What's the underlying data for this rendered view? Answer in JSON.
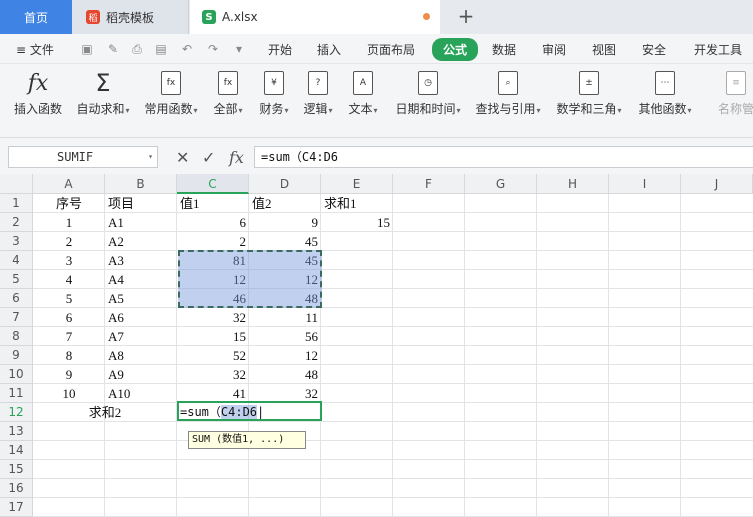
{
  "tabs": {
    "home": "首页",
    "template": "稻壳模板",
    "file": "A.xlsx",
    "template_icon": "稻",
    "file_icon": "S",
    "new_tab_icon": "+"
  },
  "menu": {
    "file": "≡ 文件",
    "items": [
      "开始",
      "插入",
      "页面布局",
      "公式",
      "数据",
      "审阅",
      "视图",
      "安全",
      "开发工具"
    ],
    "active": "公式"
  },
  "ribbon": [
    {
      "label": "插入函数",
      "icon": "fx"
    },
    {
      "label": "自动求和",
      "icon": "Σ"
    },
    {
      "label": "常用函数",
      "icon": "fx"
    },
    {
      "label": "全部",
      "icon": "fx"
    },
    {
      "label": "财务",
      "icon": "¥"
    },
    {
      "label": "逻辑",
      "icon": "?"
    },
    {
      "label": "文本",
      "icon": "A"
    },
    {
      "label": "日期和时间",
      "icon": "◷"
    },
    {
      "label": "查找与引用",
      "icon": "⌕"
    },
    {
      "label": "数学和三角",
      "icon": "±"
    },
    {
      "label": "其他函数",
      "icon": "⋯"
    },
    {
      "label": "名称管",
      "icon": "≡"
    }
  ],
  "formula_bar": {
    "name_box": "SUMIF",
    "cancel_icon": "✕",
    "confirm_icon": "✓",
    "fx_icon": "fx",
    "formula": "=sum（C4:D6"
  },
  "columns": [
    "A",
    "B",
    "C",
    "D",
    "E",
    "F",
    "G",
    "H",
    "I",
    "J"
  ],
  "rows": [
    "1",
    "2",
    "3",
    "4",
    "5",
    "6",
    "7",
    "8",
    "9",
    "10",
    "11",
    "12",
    "13",
    "14",
    "15",
    "16",
    "17"
  ],
  "sheet": {
    "headers": [
      "序号",
      "项目",
      "值1",
      "值2",
      "求和1"
    ],
    "data": [
      [
        "1",
        "A1",
        "6",
        "9",
        "15"
      ],
      [
        "2",
        "A2",
        "2",
        "45",
        ""
      ],
      [
        "3",
        "A3",
        "81",
        "45",
        ""
      ],
      [
        "4",
        "A4",
        "12",
        "12",
        ""
      ],
      [
        "5",
        "A5",
        "46",
        "48",
        ""
      ],
      [
        "6",
        "A6",
        "32",
        "11",
        ""
      ],
      [
        "7",
        "A7",
        "15",
        "56",
        ""
      ],
      [
        "8",
        "A8",
        "52",
        "12",
        ""
      ],
      [
        "9",
        "A9",
        "32",
        "48",
        ""
      ],
      [
        "10",
        "A10",
        "41",
        "32",
        ""
      ]
    ],
    "row12_label": "求和2",
    "row12_formula_prefix": "=sum（",
    "row12_formula_ref": "C4:D6"
  },
  "tooltip": "SUM (数值1, ...)"
}
